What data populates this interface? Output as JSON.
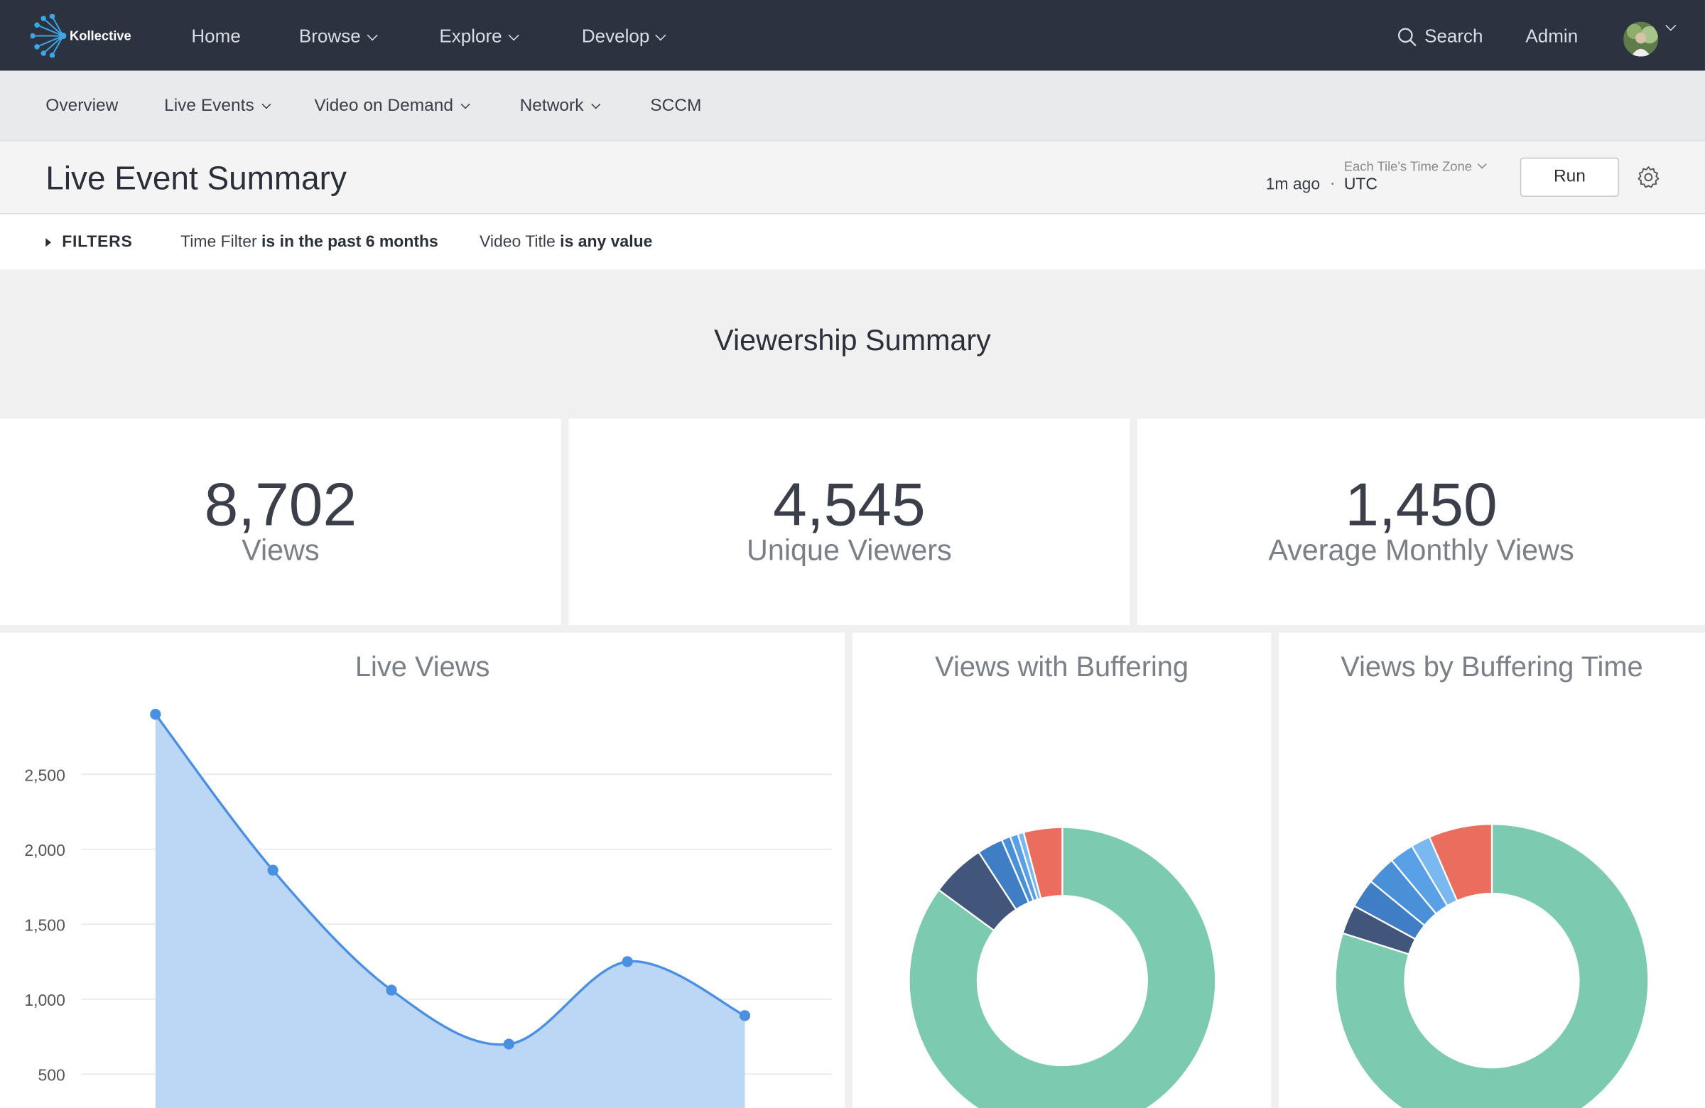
{
  "brand": {
    "name": "Kollective"
  },
  "topnav": {
    "items": [
      {
        "label": "Home"
      },
      {
        "label": "Browse"
      },
      {
        "label": "Explore"
      },
      {
        "label": "Develop"
      }
    ],
    "search_label": "Search",
    "admin_label": "Admin"
  },
  "subnav": {
    "items": [
      {
        "label": "Overview"
      },
      {
        "label": "Live Events"
      },
      {
        "label": "Video on Demand"
      },
      {
        "label": "Network"
      },
      {
        "label": "SCCM"
      }
    ]
  },
  "page": {
    "title": "Live Event Summary",
    "last_run": "1m ago",
    "timezone_label": "Each Tile's Time Zone",
    "timezone_value": "UTC",
    "run_label": "Run"
  },
  "filters": {
    "label": "FILTERS",
    "chips": [
      {
        "name": "Time Filter",
        "value": "is in the past 6 months"
      },
      {
        "name": "Video Title",
        "value": "is any value"
      }
    ]
  },
  "section": {
    "title": "Viewership Summary"
  },
  "kpis": [
    {
      "value": "8,702",
      "label": "Views"
    },
    {
      "value": "4,545",
      "label": "Unique Viewers"
    },
    {
      "value": "1,450",
      "label": "Average Monthly Views"
    }
  ],
  "chart_data": [
    {
      "type": "area",
      "title": "Live Views",
      "y": [
        2900,
        1860,
        1060,
        700,
        1250,
        890
      ],
      "yticks": [
        "2,500",
        "2,000",
        "1,500",
        "1,000",
        "500"
      ],
      "ytick_values": [
        2500,
        2000,
        1500,
        1000,
        500
      ],
      "grid": true,
      "color": "#4a90e2",
      "fill": "#bcd6f5"
    },
    {
      "type": "pie",
      "title": "Views with Buffering",
      "values": [
        81.5,
        5.5,
        2.6,
        0.9,
        0.8,
        0.6,
        3.9
      ],
      "colors": [
        "#7ccbb0",
        "#42557a",
        "#3f7ec4",
        "#4a90d9",
        "#5aa0e6",
        "#7ab8f2",
        "#ea6d5d"
      ]
    },
    {
      "type": "pie",
      "title": "Views by Buffering Time",
      "values": [
        79.5,
        3.0,
        3.0,
        3.0,
        2.5,
        2.0,
        6.5
      ],
      "colors": [
        "#7ccbb0",
        "#42557a",
        "#3f7ec4",
        "#4a90d9",
        "#5aa0e6",
        "#7ab8f2",
        "#ea6d5d"
      ]
    }
  ]
}
